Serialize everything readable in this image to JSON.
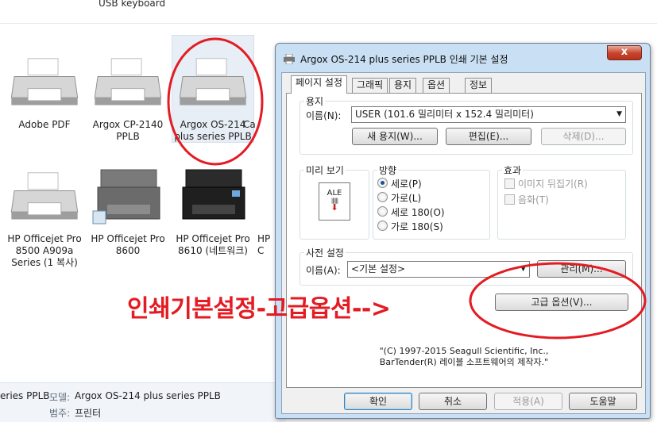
{
  "explorer": {
    "top_label": "USB keyboard",
    "devices": [
      {
        "name": "Adobe PDF"
      },
      {
        "name": "Argox CP-2140\nPPLB"
      },
      {
        "name": "Argox OS-214\nplus series PPLB"
      },
      {
        "name": "Ca"
      },
      {
        "name": "HP Officejet Pro\n8500 A909a\nSeries (1 복사)"
      },
      {
        "name": "HP Officejet Pro\n8600"
      },
      {
        "name": "HP Officejet Pro\n8610 (네트워크)"
      },
      {
        "name": "HP\nC"
      }
    ],
    "status": {
      "name_fragment": "eries  PPLB",
      "model_label": "모델:",
      "model_value": "Argox OS-214 plus series PPLB",
      "category_label": "범주:",
      "category_value": "프린터"
    }
  },
  "annotation": {
    "text": "인쇄기본설정-고급옵션-->",
    "color": "#e31b23"
  },
  "dialog": {
    "title": "Argox OS-214 plus series PPLB 인쇄 기본 설정",
    "close_label": "x",
    "tabs": [
      "페이지 설정",
      "그래픽",
      "용지",
      "옵션",
      "정보"
    ],
    "paper_group": {
      "label": "용지",
      "name_label": "이름(N):",
      "name_value": "USER (101.6 밀리미터 x 152.4 밀리미터)",
      "new_button": "새 용지(W)...",
      "edit_button": "편집(E)...",
      "delete_button": "삭제(D)..."
    },
    "preview_group": {
      "label": "미리 보기",
      "preview_text": "ALE"
    },
    "orientation_group": {
      "label": "방향",
      "options": [
        "세로(P)",
        "가로(L)",
        "세로 180(O)",
        "가로 180(S)"
      ],
      "selected": "세로(P)"
    },
    "effects_group": {
      "label": "효과",
      "options": [
        "이미지 뒤집기(R)",
        "음화(T)"
      ]
    },
    "preset_group": {
      "label": "사전 설정",
      "name_label": "이름(A):",
      "name_value": "<기본 설정>",
      "manage_button": "관리(M)..."
    },
    "advanced_button": "고급 옵션(V)...",
    "copyright_line1": "\"(C) 1997-2015 Seagull Scientific, Inc.,",
    "copyright_line2": "BarTender(R) 레이블 소프트웨어의 제작자.\"",
    "footer": {
      "ok": "확인",
      "cancel": "취소",
      "apply": "적용(A)",
      "help": "도움말"
    }
  },
  "colors": {
    "accent": "#e31b23",
    "dialog_frame": "#c9dff3"
  }
}
